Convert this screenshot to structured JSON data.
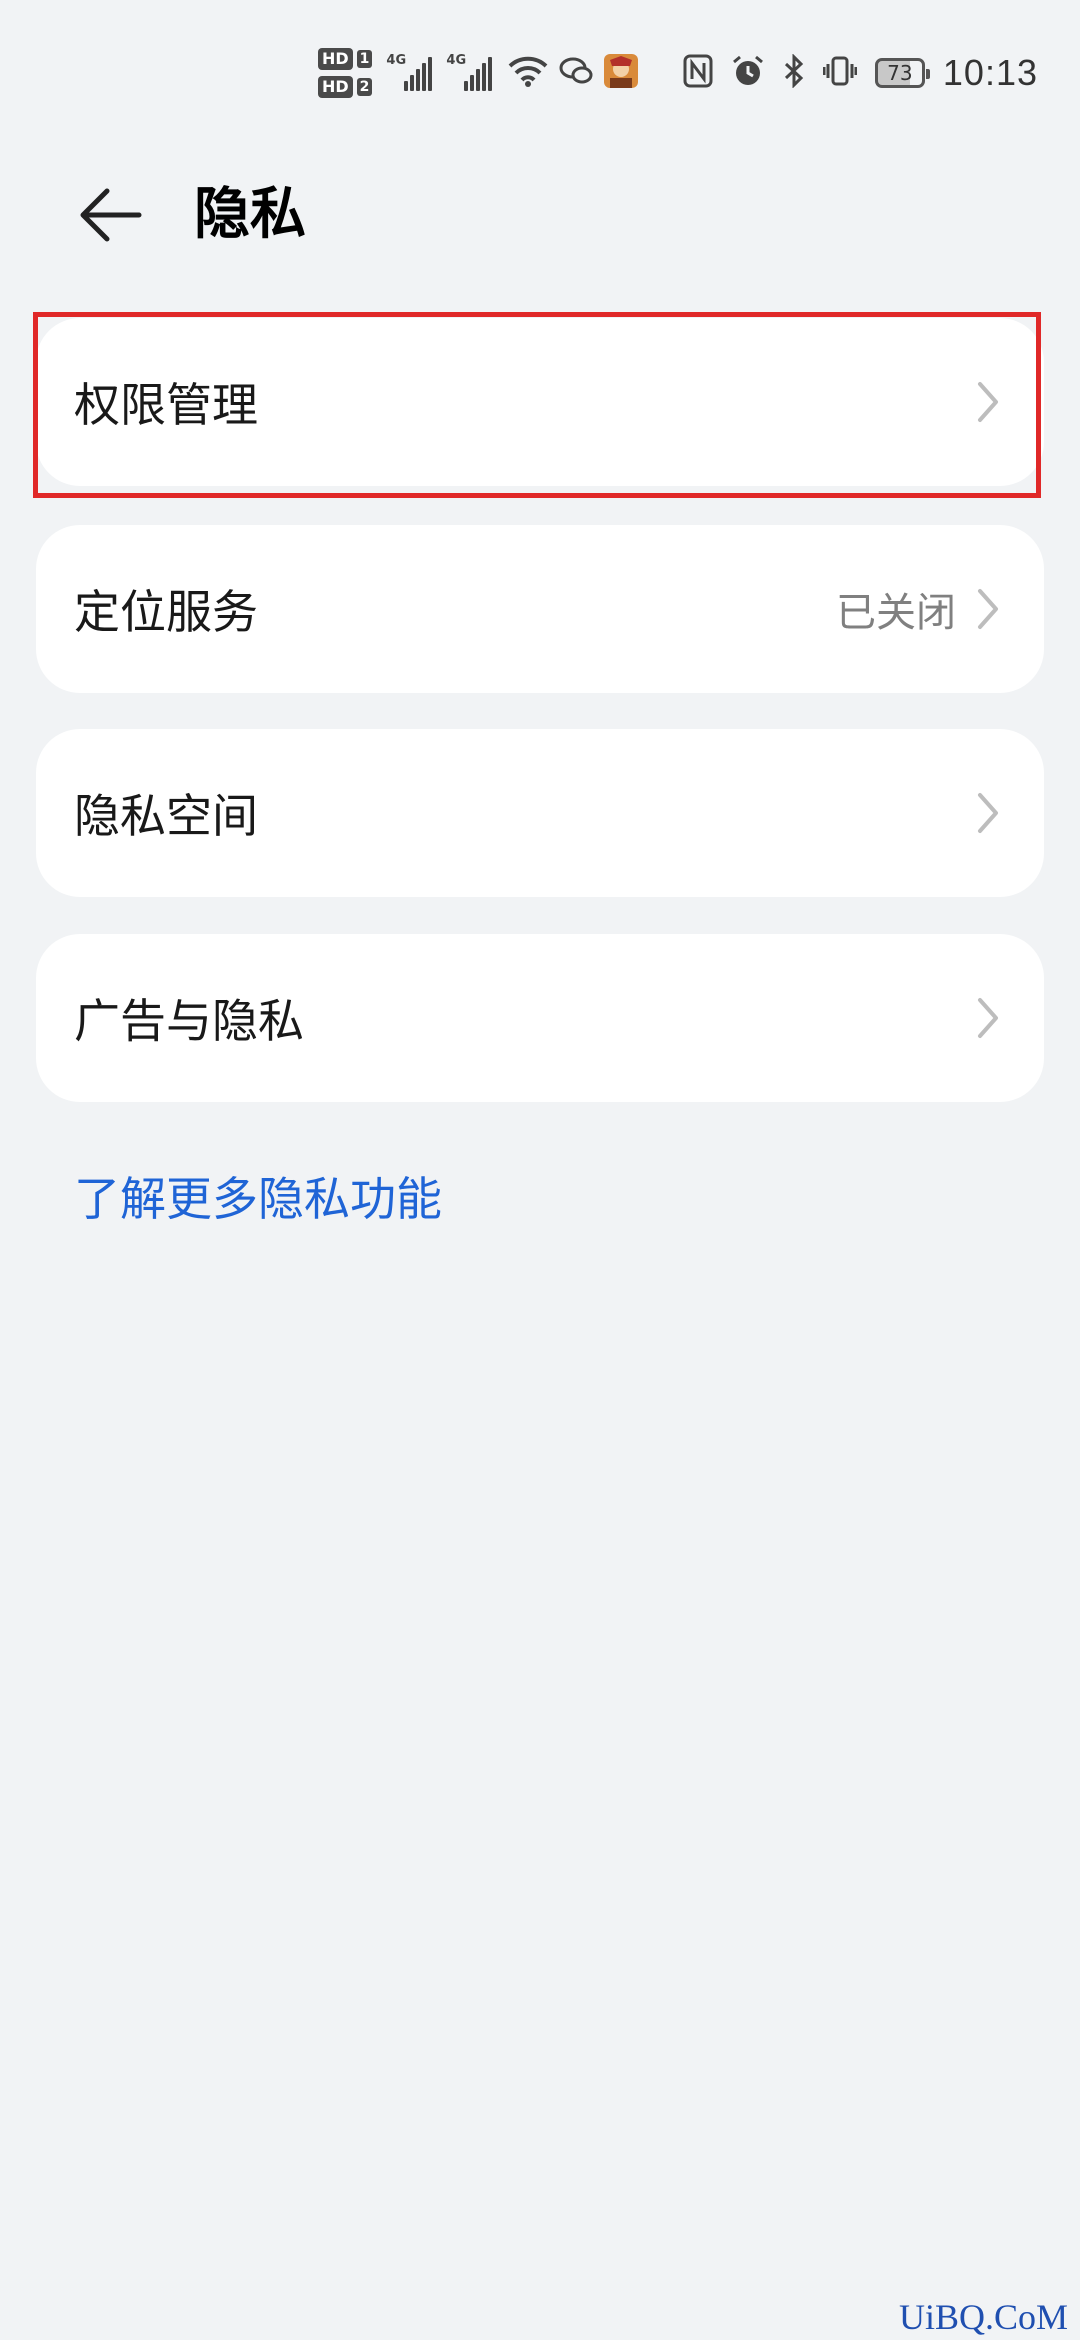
{
  "status_bar": {
    "sim1": {
      "hd": "HD",
      "num": "1",
      "net": "4G"
    },
    "sim2": {
      "hd": "HD",
      "num": "2",
      "net": "4G"
    },
    "battery": "73",
    "time": "10:13",
    "icons": [
      "wifi-icon",
      "chat-bubble-icon",
      "app-avatar-icon",
      "nfc-icon",
      "alarm-icon",
      "bluetooth-icon",
      "vibrate-icon"
    ]
  },
  "header": {
    "title": "隐私"
  },
  "items": [
    {
      "label": "权限管理",
      "value": ""
    },
    {
      "label": "定位服务",
      "value": "已关闭"
    },
    {
      "label": "隐私空间",
      "value": ""
    },
    {
      "label": "广告与隐私",
      "value": ""
    }
  ],
  "more_link": "了解更多隐私功能",
  "watermark": "UiBQ.CoM",
  "colors": {
    "background": "#f1f3f5",
    "link": "#1f64d6",
    "highlight": "#e02828"
  }
}
